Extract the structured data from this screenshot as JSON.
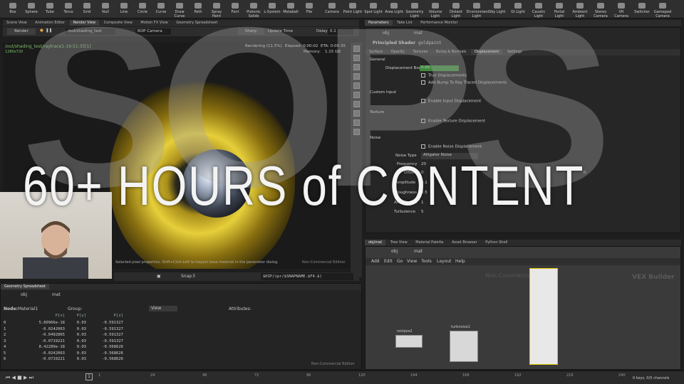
{
  "shelf": {
    "tools": [
      "Box",
      "Sphere",
      "Tube",
      "Torus",
      "Grid",
      "Null",
      "Line",
      "Circle",
      "Curve",
      "Draw Curve",
      "Path",
      "Spray Paint",
      "Font",
      "Platonic Solids",
      "L-System",
      "Metaball",
      "File"
    ],
    "light_tools": [
      "Camera",
      "Point Light",
      "Spot Light",
      "Area Light",
      "Geometry Light",
      "Volume Light",
      "Distant Light",
      "Environment Light",
      "Sky Light",
      "GI Light",
      "Caustic Light",
      "Portal Light",
      "Ambient Light",
      "Stereo Camera",
      "VR Camera",
      "Switcher",
      "Gamepad Camera"
    ]
  },
  "left_tabs": [
    "Scene View",
    "Animation Editor",
    "Render View",
    "Composite View",
    "Motion FX View",
    "Geometry Spreadsheet"
  ],
  "render_toolbar": {
    "render_button": "Render",
    "path": "/out/shading_test",
    "camera": "ROP Camera",
    "sharp": "Sharp",
    "update_time": "Update Time",
    "delay_label": "Delay",
    "delay_value": "0.1"
  },
  "viewport": {
    "path": "/out/shading_test/raytrace1-19:51:35[1]",
    "resolution": "1280x720",
    "status": "Rendering (11.5%)",
    "elapsed": "Elapsed: 0:00:02",
    "eta": "ETA: 0:00:35",
    "memory_label": "Memory:",
    "memory_value": "1.15 GB",
    "hint": "Selected pixel properties. Shift+Click-Left to inspect base material in the parameter dialog.",
    "watermark": "Non-Commercial Edition",
    "snap_label": "Snap",
    "snap_value": "3",
    "output_path": "$HIP/ipr/$SNAPNAME.$F4.$("
  },
  "right_tabs": [
    "Parameters",
    "Take List",
    "Performance Monitor"
  ],
  "param_header": {
    "shader_type": "Principled Shader",
    "name": "goldpaint",
    "path_obj": "obj",
    "path_mat": "mat"
  },
  "param_tabs": [
    "Surface",
    "Opacity",
    "Textures",
    "Bump & Normals",
    "Displacement",
    "Settings"
  ],
  "params": {
    "general": "General",
    "disp_bound_label": "Displacement Bound",
    "disp_bound_value": "0.05",
    "true_disp": "True Displacements",
    "add_bump": "Add Bump To Ray Traced Displacements",
    "custom_input": "Custom Input",
    "enable_input": "Enable Input Displacement",
    "texture": "Texture",
    "enable_texture": "Enable Texture Displacement",
    "noise": "Noise",
    "enable_noise": "Enable Noise Displacement",
    "noise_type_label": "Noise Type",
    "noise_type_value": "Alligator Noise",
    "frequency_label": "Frequency",
    "frequency_value": "20",
    "offset_label": "Offset",
    "offset_value": "0",
    "offset_z": "0",
    "amplitude_label": "Amplitude",
    "amplitude_value": "0.1",
    "roughness_label": "Roughness",
    "roughness_value": "0.5",
    "attenuation_label": "Attenuation",
    "attenuation_value": "1",
    "turbulence_label": "Turbulence",
    "turbulence_value": "5"
  },
  "network": {
    "tabs": [
      "obj/mat",
      "Tree View",
      "Material Palette",
      "Asset Browser",
      "Python Shell"
    ],
    "path_obj": "obj",
    "path_mat": "mat",
    "menu": [
      "Add",
      "Edit",
      "Go",
      "View",
      "Tools",
      "Layout",
      "Help"
    ],
    "watermark": "Non-Commercial Edition",
    "context": "VEX Builder",
    "node1": "restpos2",
    "node2": "turbnoise1"
  },
  "spreadsheet": {
    "tab": "Geometry Spreadsheet",
    "path_obj": "obj",
    "path_mat": "mat",
    "node_label": "Node:",
    "node_value": "Material1",
    "group_label": "Group:",
    "view_label": "View",
    "attributes_label": "Attributes:",
    "headers": [
      "",
      "P[x]",
      "P[y]",
      "P[z]"
    ],
    "rows": [
      [
        "0",
        "5.80966e-18",
        "0.03",
        "-0.591327"
      ],
      [
        "1",
        "-0.0242063",
        "0.03",
        "-0.591327"
      ],
      [
        "2",
        "-0.0492865",
        "0.03",
        "-0.591327"
      ],
      [
        "3",
        "-0.0719221",
        "0.03",
        "-0.591327"
      ],
      [
        "4",
        "8.42289e-18",
        "0.03",
        "-0.568626"
      ],
      [
        "5",
        "-0.0242063",
        "0.03",
        "-0.568626"
      ],
      [
        "6",
        "-0.0719221",
        "0.03",
        "-0.568626"
      ]
    ],
    "watermark": "Non-Commercial Edition"
  },
  "timeline": {
    "frame": "1",
    "ticks": [
      "1",
      "24",
      "48",
      "72",
      "96",
      "120",
      "144",
      "168",
      "192",
      "216",
      "240"
    ],
    "keys": "0 keys, 0/0 channels"
  },
  "overlay": {
    "headline": "60+ HOURS of CONTENT",
    "ghost_text": "SOPS"
  }
}
